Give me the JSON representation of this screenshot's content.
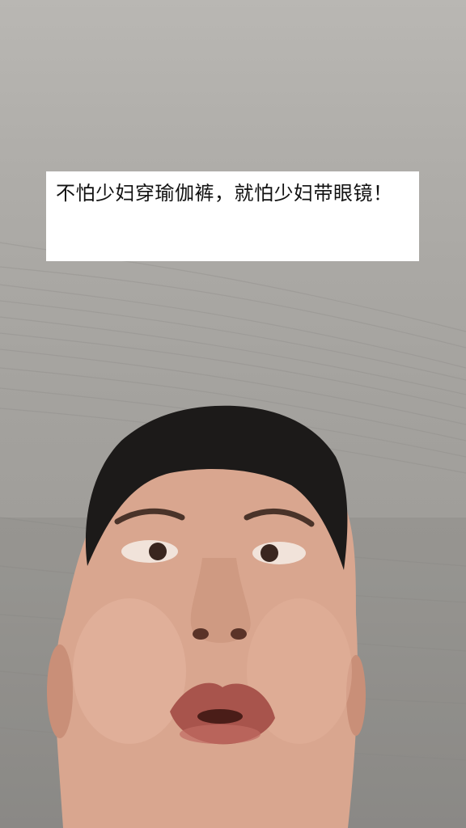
{
  "caption": {
    "text": "不怕少妇穿瑜伽裤，就怕少妇带眼镜！"
  },
  "scene": {
    "background_color": "#a9a7a3",
    "caption_bg_color": "#ffffff",
    "caption_text_color": "#111111"
  }
}
